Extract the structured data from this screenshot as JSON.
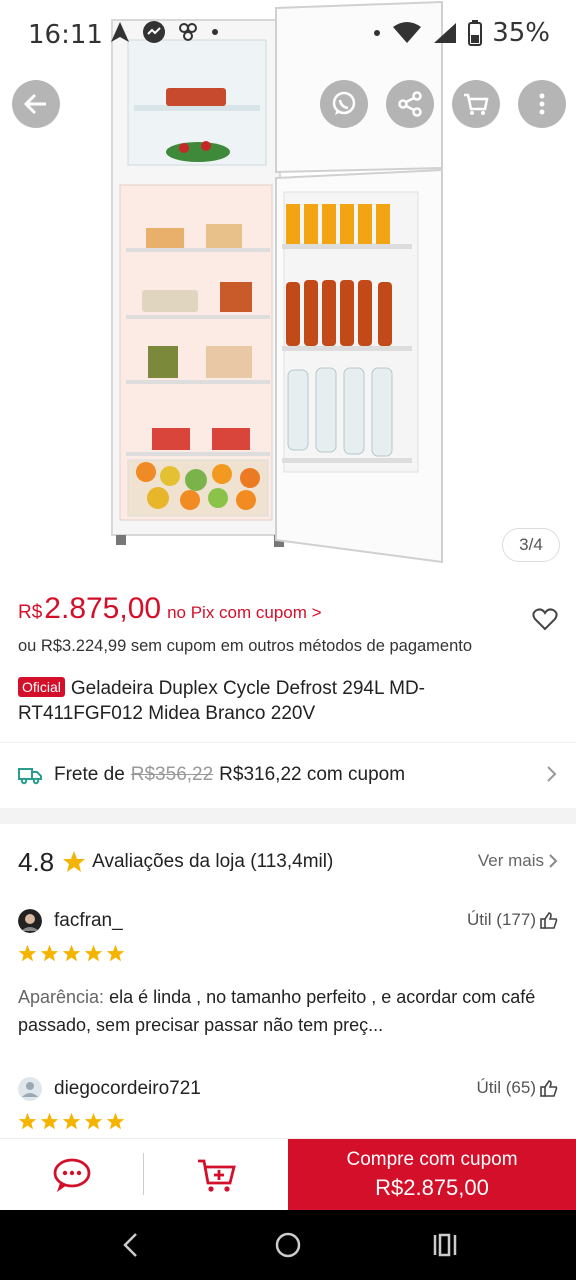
{
  "status_bar": {
    "time": "16:11",
    "battery": "35%"
  },
  "image": {
    "pager": "3/4"
  },
  "product": {
    "currency": "R$",
    "price": "2.875,00",
    "pix_label": "no Pix com cupom >",
    "alt_price": "ou R$3.224,99 sem cupom em outros métodos de pagamento",
    "official_badge": "Oficial",
    "title": "Geladeira Duplex Cycle Defrost 294L MD-RT411FGF012 Midea Branco 220V"
  },
  "shipping": {
    "label": "Frete de",
    "old_price": "R$356,22",
    "new_price": "R$316,22 com cupom"
  },
  "reviews": {
    "rating": "4.8",
    "label": "Avaliações da loja (113,4mil)",
    "see_more": "Ver mais",
    "items": [
      {
        "user": "facfran_",
        "useful": "Útil (177)",
        "stars": 5,
        "label": "Aparência:",
        "text": " ela é linda , no tamanho perfeito , e acordar com café passado, sem precisar passar não tem preç..."
      },
      {
        "user": "diegocordeiro721",
        "useful": "Útil (65)",
        "stars": 5
      }
    ]
  },
  "action_bar": {
    "buy_line1": "Compre com cupom",
    "buy_line2": "R$2.875,00"
  },
  "colors": {
    "accent": "#d40f2a",
    "star": "#f5b400"
  },
  "icons": [
    "back-arrow-icon",
    "whatsapp-icon",
    "share-icon",
    "cart-icon",
    "more-vertical-icon",
    "heart-icon",
    "truck-icon",
    "chevron-right-icon",
    "star-icon",
    "thumbs-up-icon",
    "chat-icon",
    "add-to-cart-icon"
  ]
}
